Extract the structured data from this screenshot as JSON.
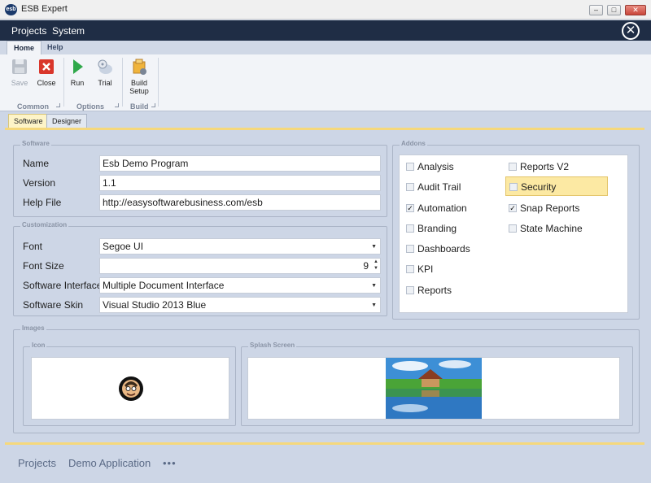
{
  "window": {
    "title": "ESB Expert",
    "icon_text": "esb"
  },
  "menu": {
    "items": [
      "Projects",
      "System"
    ]
  },
  "ribbon": {
    "tabs": [
      "Home",
      "Help"
    ],
    "groups": {
      "common": {
        "label": "Common",
        "save_label": "Save",
        "close_label": "Close"
      },
      "options": {
        "label": "Options",
        "run_label": "Run",
        "trial_label": "Trial"
      },
      "build": {
        "label": "Build",
        "build_line1": "Build",
        "build_line2": "Setup"
      }
    }
  },
  "doc_tabs": [
    "Software",
    "Designer"
  ],
  "software": {
    "legend": "Software",
    "name_label": "Name",
    "name_value": "Esb Demo Program",
    "version_label": "Version",
    "version_value": "1.1",
    "helpfile_label": "Help File",
    "helpfile_value": "http://easysoftwarebusiness.com/esb"
  },
  "customization": {
    "legend": "Customization",
    "font_label": "Font",
    "font_value": "Segoe UI",
    "fontsize_label": "Font Size",
    "fontsize_value": "9",
    "interface_label": "Software Interface",
    "interface_value": "Multiple Document Interface",
    "skin_label": "Software Skin",
    "skin_value": "Visual Studio 2013 Blue"
  },
  "addons": {
    "legend": "Addons",
    "items": [
      {
        "label": "Analysis",
        "checked": false
      },
      {
        "label": "Audit Trail",
        "checked": false
      },
      {
        "label": "Automation",
        "checked": true
      },
      {
        "label": "Branding",
        "checked": false
      },
      {
        "label": "Dashboards",
        "checked": false
      },
      {
        "label": "KPI",
        "checked": false
      },
      {
        "label": "Reports",
        "checked": false
      },
      {
        "label": "Reports V2",
        "checked": false
      },
      {
        "label": "Security",
        "checked": false,
        "highlighted": true
      },
      {
        "label": "Snap Reports",
        "checked": true
      },
      {
        "label": "State Machine",
        "checked": false
      }
    ]
  },
  "images": {
    "legend": "Images",
    "icon_legend": "Icon",
    "splash_legend": "Splash Screen"
  },
  "bottom_nav": {
    "items": [
      "Projects",
      "Demo Application"
    ],
    "more": "•••"
  },
  "colors": {
    "menubar": "#1f2d45",
    "accent_yellow": "#f5d87c",
    "highlight": "#fce9a3",
    "background": "#cdd6e6"
  }
}
